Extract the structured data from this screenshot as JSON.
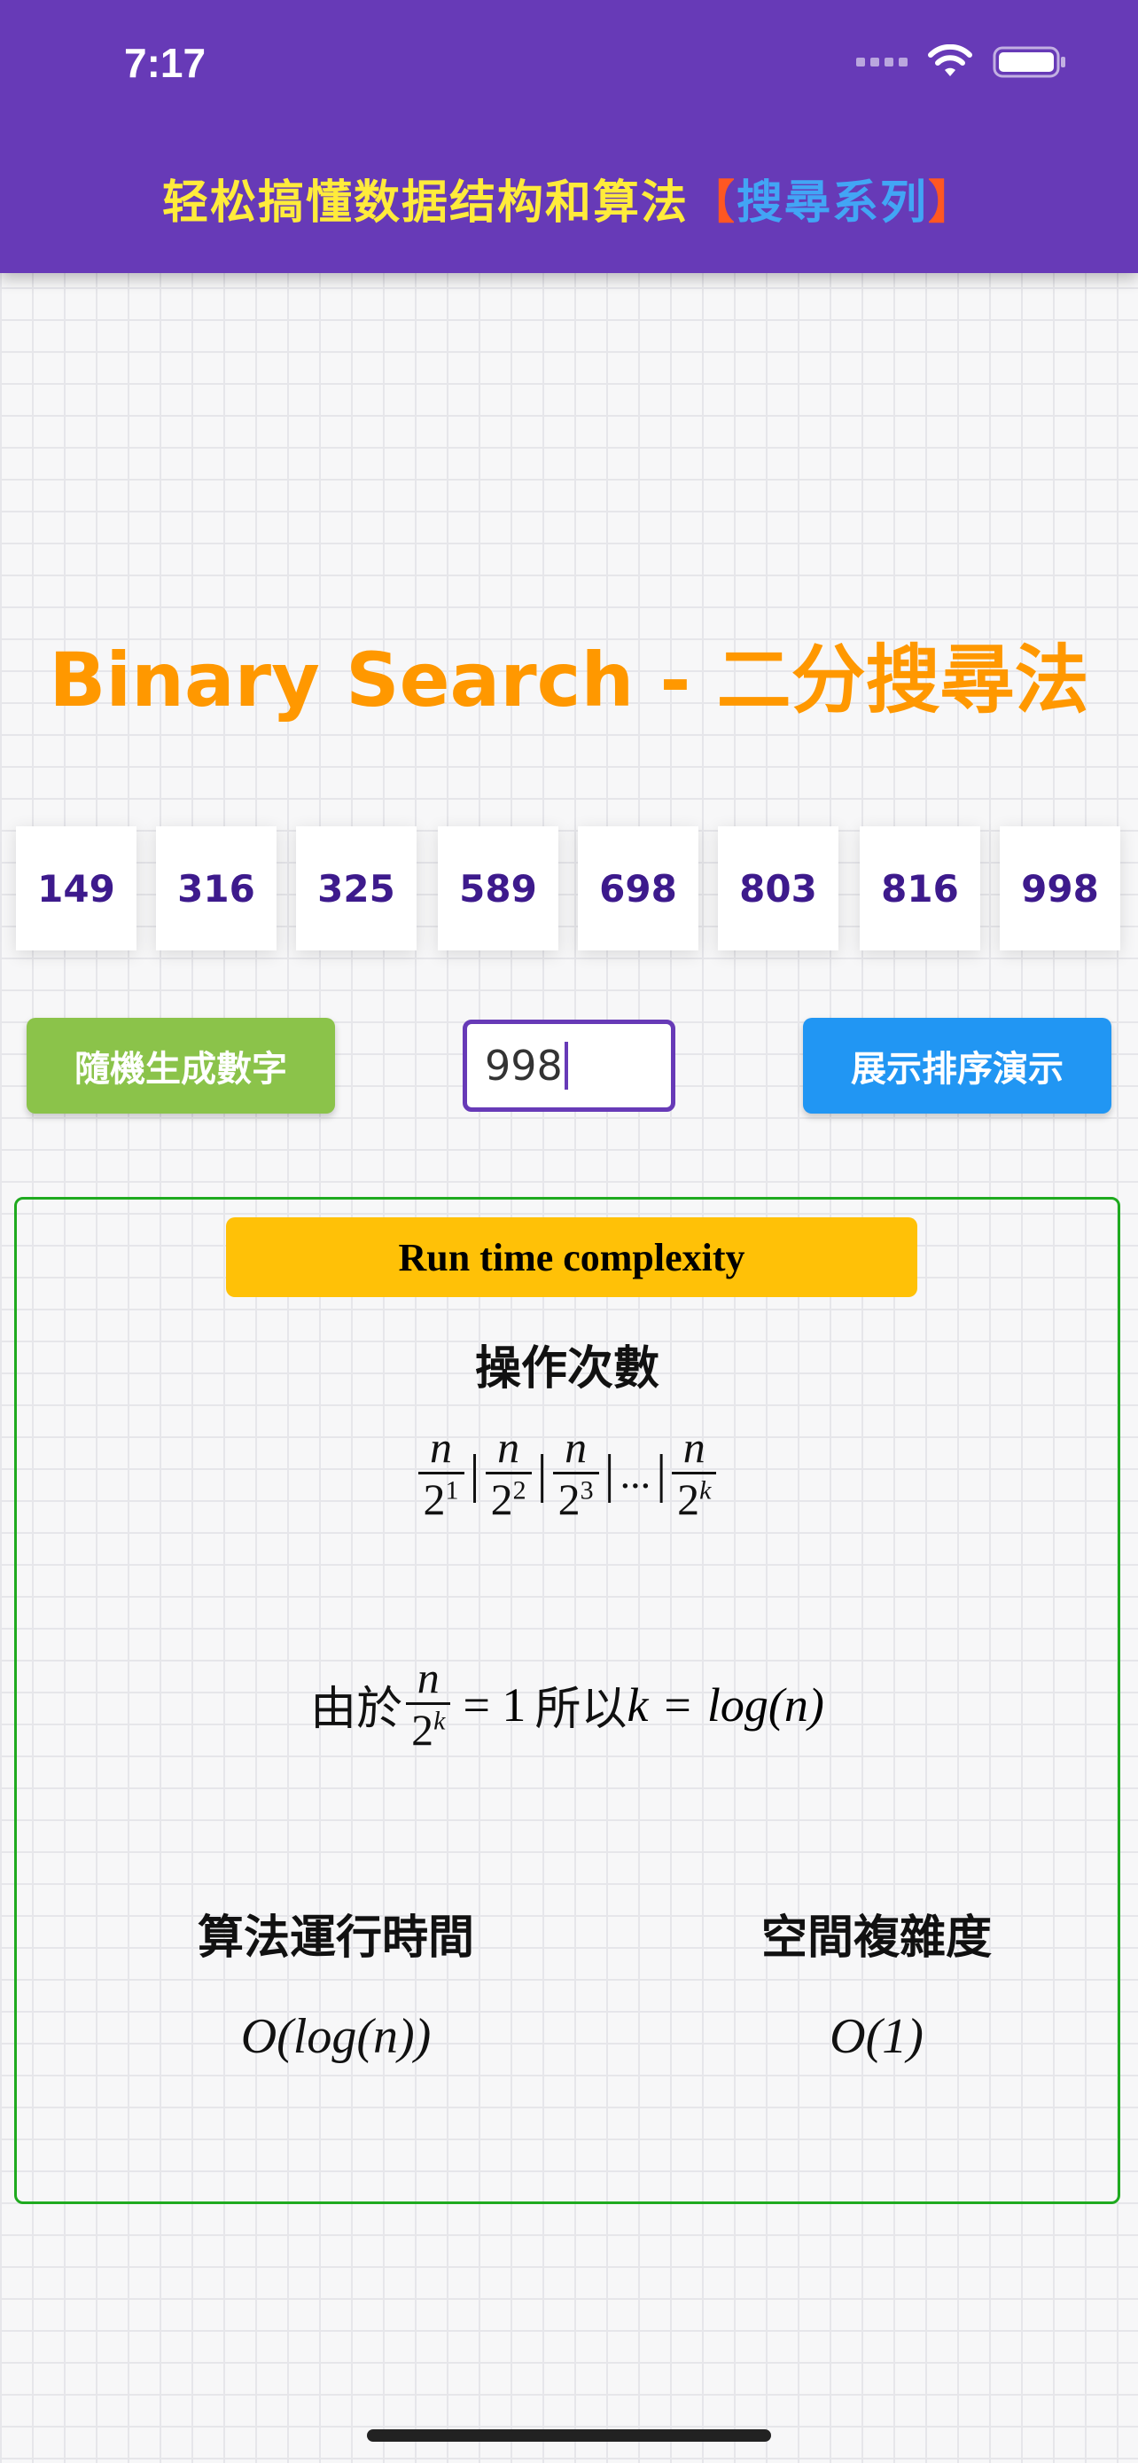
{
  "status": {
    "time": "7:17"
  },
  "app_bar": {
    "title_main": "轻松搞懂数据结构和算法",
    "bracket_open": "【",
    "series": "搜尋系列",
    "bracket_close": "】"
  },
  "heading": "Binary Search - 二分搜尋法",
  "numbers": [
    "149",
    "316",
    "325",
    "589",
    "698",
    "803",
    "816",
    "998"
  ],
  "controls": {
    "random_button": "隨機生成數字",
    "target_value": "998",
    "demo_button": "展示排序演示"
  },
  "complexity": {
    "title": "Run time complexity",
    "ops_label": "操作次數",
    "ops_formula": {
      "numerator": "n",
      "base": "2",
      "exponents": [
        "1",
        "2",
        "3"
      ],
      "last_exponent": "k",
      "ellipsis": "..."
    },
    "derivation": {
      "prefix": "由於",
      "equals_one": "= 1",
      "middle": "所以",
      "k": "k",
      "equals": "=",
      "result": "log(n)"
    },
    "time_label": "算法運行時間",
    "time_value": "O(log(n))",
    "space_label": "空間複雜度",
    "space_value": "O(1)"
  },
  "colors": {
    "app_bar": "#673ab7",
    "heading": "#ff9800",
    "random_button": "#8bc34a",
    "demo_button": "#2196f3",
    "panel_title": "#ffc107",
    "panel_border": "#1faa1f"
  }
}
